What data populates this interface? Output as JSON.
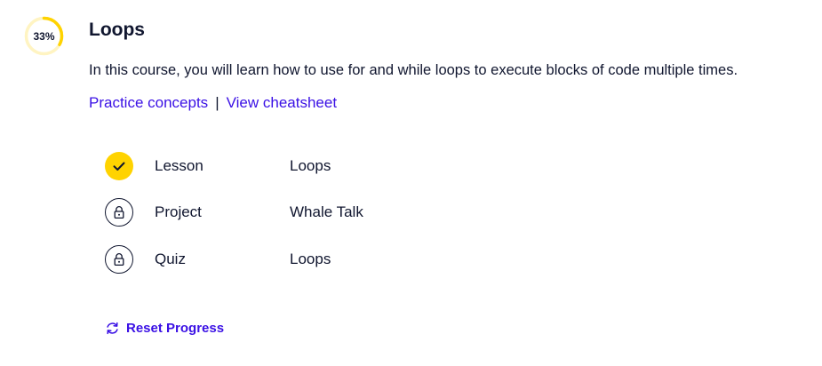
{
  "module": {
    "progress_label": "33%",
    "progress_fraction": 0.33,
    "title": "Loops",
    "description": "In this course, you will learn how to use for and while loops to execute blocks of code multiple times."
  },
  "links": {
    "practice": "Practice concepts",
    "separator": "|",
    "cheatsheet": "View cheatsheet"
  },
  "items": [
    {
      "type": "Lesson",
      "name": "Loops",
      "status": "completed",
      "icon": "checkmark-icon"
    },
    {
      "type": "Project",
      "name": "Whale Talk",
      "status": "locked",
      "icon": "lock-icon"
    },
    {
      "type": "Quiz",
      "name": "Loops",
      "status": "locked",
      "icon": "lock-icon"
    }
  ],
  "reset": {
    "label": "Reset Progress",
    "icon": "refresh-icon"
  },
  "colors": {
    "accent": "#3a10e5",
    "progress": "#ffd300",
    "progress_track": "#fff4c2",
    "text": "#10162f"
  }
}
